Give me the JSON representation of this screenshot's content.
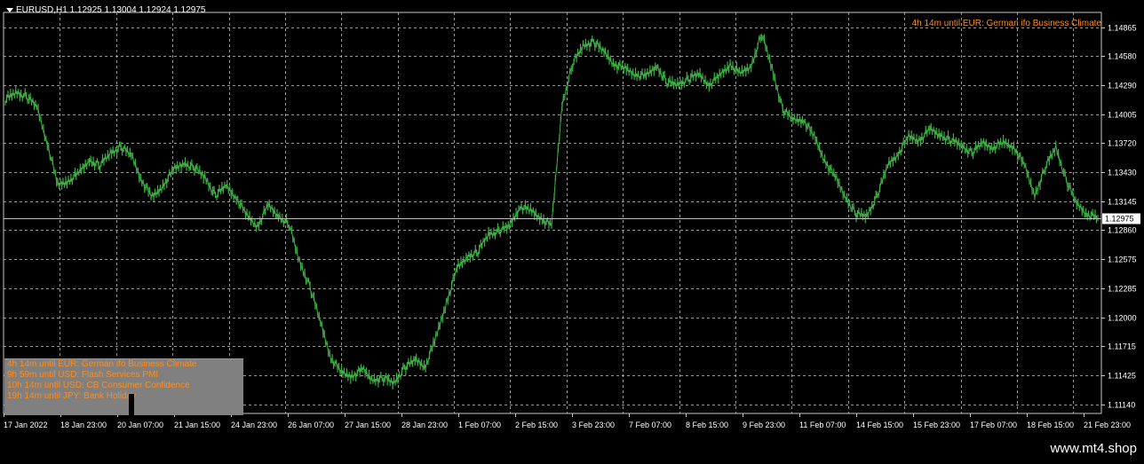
{
  "header": {
    "symbol_line": "EURUSD,H1  1.12925 1.13004 1.12924 1.12975"
  },
  "countdown_top": "4h 14m until EUR: German ifo Business Climate",
  "news_panel": {
    "lines": [
      "4h 14m until EUR: German ifo Business Climate",
      "9h 59m until USD: Flash Services PMI",
      "10h 14m until USD: CB Consumer Confidence",
      "19h 14m until JPY: Bank Holiday"
    ]
  },
  "watermark": "www.mt4.shop",
  "colors": {
    "background": "#000000",
    "candles": "#3cb043",
    "grid": "#c8c8c8",
    "text_orange": "#ff8c1a",
    "panel": "#808080"
  },
  "chart_data": {
    "type": "line",
    "symbol": "EURUSD",
    "timeframe": "H1",
    "last_price": "1.12975",
    "y_ticks": [
      "1.14865",
      "1.14580",
      "1.14290",
      "1.14005",
      "1.13720",
      "1.13430",
      "1.13145",
      "1.12860",
      "1.12575",
      "1.12285",
      "1.12000",
      "1.11715",
      "1.11425",
      "1.11140"
    ],
    "x_ticks": [
      "17 Jan 2022",
      "18 Jan 23:00",
      "20 Jan 07:00",
      "21 Jan 15:00",
      "24 Jan 23:00",
      "26 Jan 07:00",
      "27 Jan 15:00",
      "28 Jan 23:00",
      "1 Feb 07:00",
      "2 Feb 15:00",
      "3 Feb 23:00",
      "7 Feb 07:00",
      "8 Feb 15:00",
      "9 Feb 23:00",
      "11 Feb 07:00",
      "14 Feb 15:00",
      "15 Feb 23:00",
      "17 Feb 07:00",
      "18 Feb 15:00",
      "21 Feb 23:00"
    ],
    "ylim": [
      1.1105,
      1.1501
    ],
    "grid": true,
    "series": [
      {
        "values": [
          1.1415,
          1.1422,
          1.1418,
          1.1408,
          1.1372,
          1.133,
          1.1335,
          1.1342,
          1.1355,
          1.135,
          1.1362,
          1.1368,
          1.136,
          1.1335,
          1.1318,
          1.133,
          1.1345,
          1.1352,
          1.1348,
          1.1338,
          1.132,
          1.133,
          1.1318,
          1.13,
          1.129,
          1.131,
          1.13,
          1.1292,
          1.1255,
          1.123,
          1.1195,
          1.116,
          1.1145,
          1.1142,
          1.1148,
          1.1138,
          1.114,
          1.1135,
          1.115,
          1.1158,
          1.1152,
          1.118,
          1.1215,
          1.1248,
          1.126,
          1.1265,
          1.1282,
          1.1285,
          1.129,
          1.131,
          1.1305,
          1.1298,
          1.129,
          1.141,
          1.145,
          1.1468,
          1.1472,
          1.1462,
          1.145,
          1.1445,
          1.144,
          1.1438,
          1.1448,
          1.1432,
          1.143,
          1.1435,
          1.144,
          1.143,
          1.1438,
          1.145,
          1.144,
          1.1448,
          1.148,
          1.1445,
          1.1405,
          1.1395,
          1.1395,
          1.1378,
          1.1355,
          1.1338,
          1.1318,
          1.1302,
          1.13,
          1.132,
          1.135,
          1.1362,
          1.1378,
          1.1375,
          1.1385,
          1.138,
          1.1375,
          1.137,
          1.1362,
          1.1372,
          1.1368,
          1.1372,
          1.1368,
          1.135,
          1.132,
          1.1348,
          1.1368,
          1.1335,
          1.1312,
          1.1302,
          1.1298
        ]
      }
    ]
  }
}
